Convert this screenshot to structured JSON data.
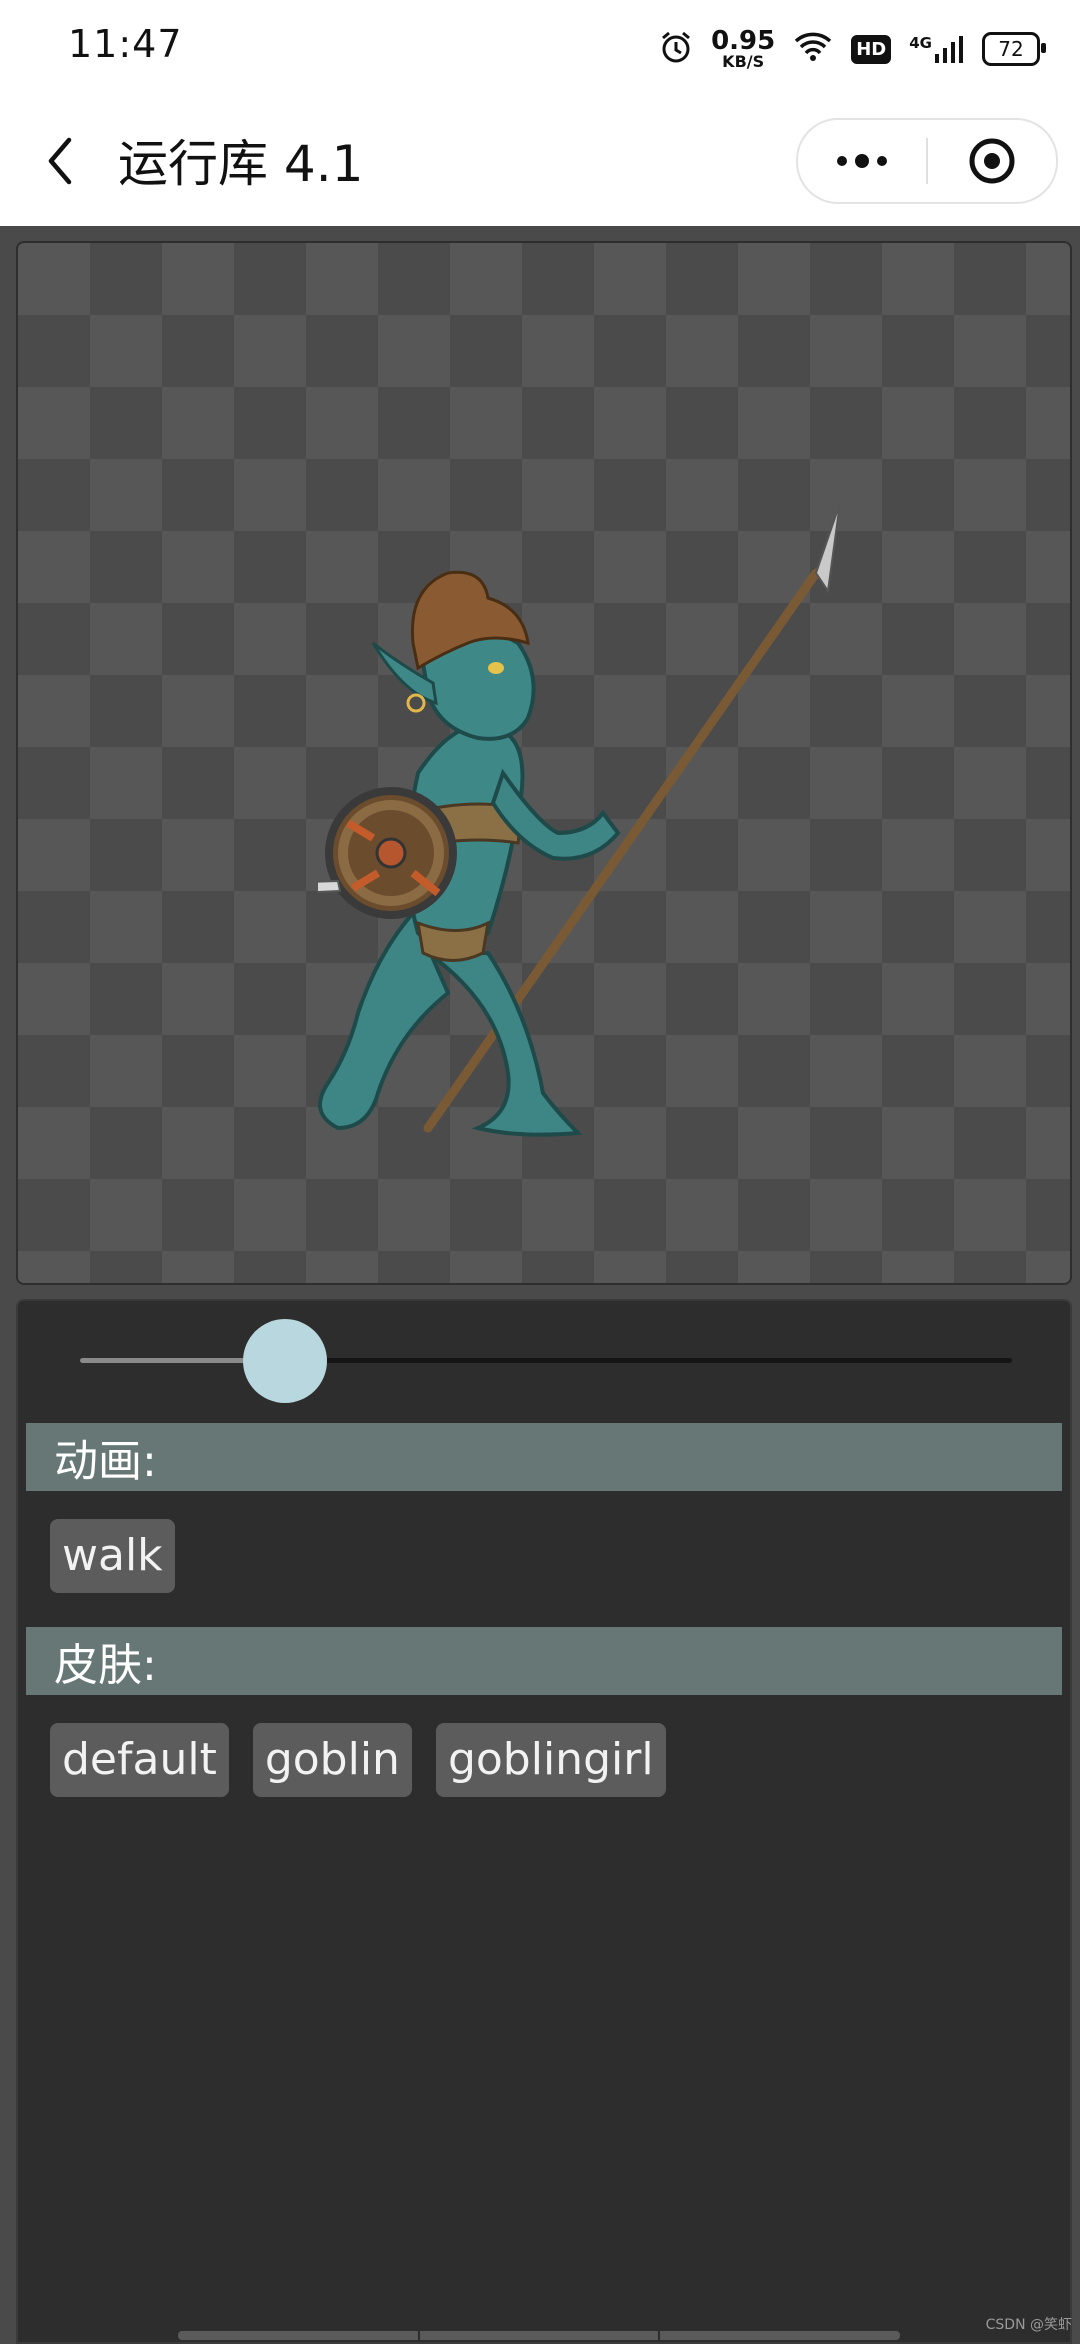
{
  "status_bar": {
    "time": "11:47",
    "net_speed_value": "0.95",
    "net_speed_unit": "KB/S",
    "hd_label": "HD",
    "network_label": "4G",
    "battery": "72"
  },
  "nav": {
    "title": "运行库 4.1",
    "icons": [
      "back-arrow-icon",
      "more-dots-icon",
      "record-target-icon"
    ]
  },
  "canvas": {
    "character_icon": "goblin-girl-spear-shield"
  },
  "controls": {
    "slider": {
      "value": 0.22
    },
    "animation_header": "动画:",
    "animations": [
      "walk"
    ],
    "skin_header": "皮肤:",
    "skins": [
      "default",
      "goblin",
      "goblingirl"
    ]
  },
  "watermark": "CSDN @笑虾",
  "colors": {
    "header_bg": "#677776",
    "thumb": "#b9d7de",
    "panel_bg": "#2d2d2d",
    "chip_bg": "#5c5c5c"
  }
}
